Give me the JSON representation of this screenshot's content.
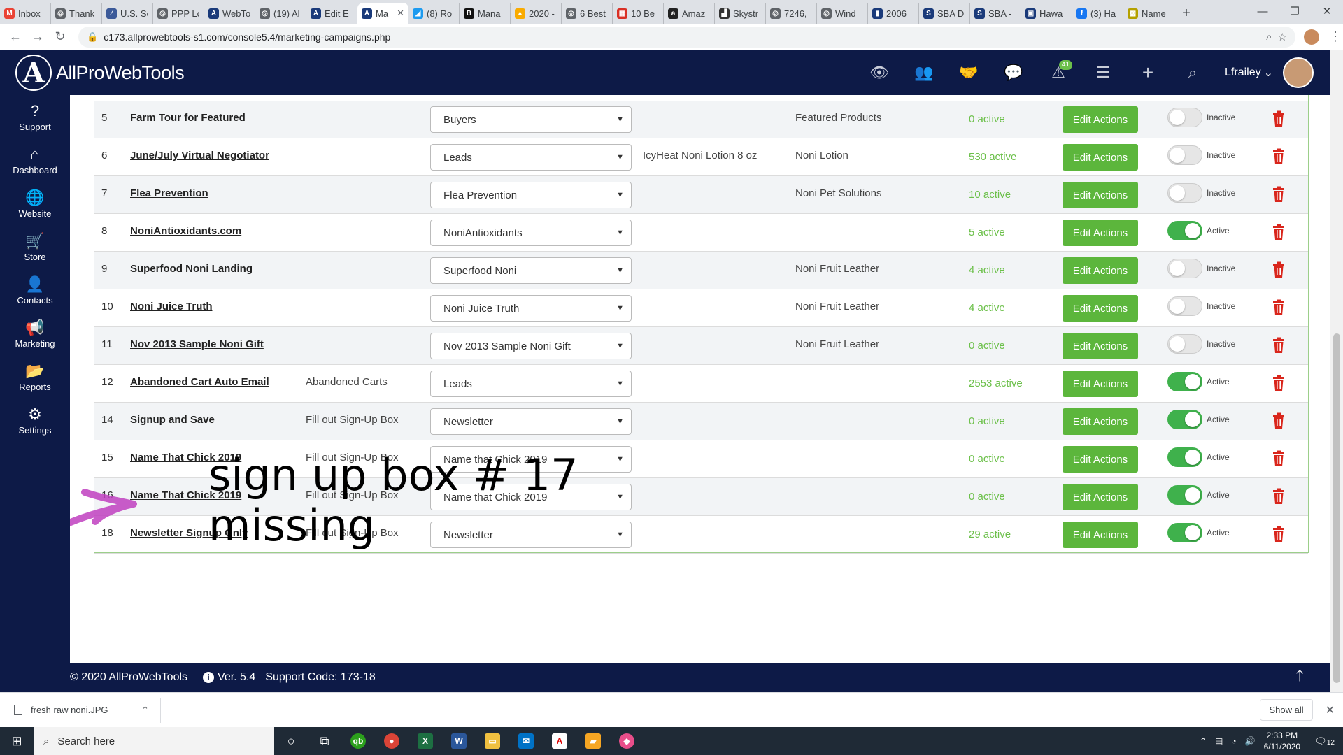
{
  "browser": {
    "tabs": [
      {
        "title": "Inbox",
        "color": "#ea4335",
        "glyph": "M"
      },
      {
        "title": "Thank",
        "color": "#5f6368",
        "glyph": "◎"
      },
      {
        "title": "U.S. Se",
        "color": "#3c5a99",
        "glyph": "⁄"
      },
      {
        "title": "PPP Lo",
        "color": "#5f6368",
        "glyph": "◎"
      },
      {
        "title": "WebTo",
        "color": "#1a3a7a",
        "glyph": "A"
      },
      {
        "title": "(19) Al",
        "color": "#5f6368",
        "glyph": "◎"
      },
      {
        "title": "Edit E",
        "color": "#1a3a7a",
        "glyph": "A"
      },
      {
        "title": "Ma",
        "color": "#1a3a7a",
        "glyph": "A"
      },
      {
        "title": "(8) Ro",
        "color": "#1d9bf0",
        "glyph": "◢"
      },
      {
        "title": "Mana",
        "color": "#111",
        "glyph": "B"
      },
      {
        "title": "2020 -",
        "color": "#f9ab00",
        "glyph": "▲"
      },
      {
        "title": "6 Best",
        "color": "#5f6368",
        "glyph": "◎"
      },
      {
        "title": "10 Be",
        "color": "#d93025",
        "glyph": "▦"
      },
      {
        "title": "Amaz",
        "color": "#222",
        "glyph": "a"
      },
      {
        "title": "Skystr",
        "color": "#333",
        "glyph": "▟"
      },
      {
        "title": "7246,",
        "color": "#5f6368",
        "glyph": "◎"
      },
      {
        "title": "Wind",
        "color": "#5f6368",
        "glyph": "◎"
      },
      {
        "title": "2006",
        "color": "#1a3a7a",
        "glyph": "▮"
      },
      {
        "title": "SBA D",
        "color": "#1a3a7a",
        "glyph": "S"
      },
      {
        "title": "SBA -",
        "color": "#1a3a7a",
        "glyph": "S"
      },
      {
        "title": "Hawa",
        "color": "#1a3a7a",
        "glyph": "▣"
      },
      {
        "title": "(3) Ha",
        "color": "#1877f2",
        "glyph": "f"
      },
      {
        "title": "Name",
        "color": "#b5a100",
        "glyph": "▩"
      }
    ],
    "active_tab_index": 7,
    "url": "c173.allprowebtools-s1.com/console5.4/marketing-campaigns.php"
  },
  "header": {
    "logo_letter": "A",
    "brand": "AllProWebTools",
    "notification_count": "41",
    "username": "Lfrailey"
  },
  "sidebar": {
    "items": [
      {
        "label": "Support",
        "icon": "question-circle-icon",
        "glyph": "?"
      },
      {
        "label": "Dashboard",
        "icon": "home-icon",
        "glyph": "⌂"
      },
      {
        "label": "Website",
        "icon": "globe-icon",
        "glyph": "🌐"
      },
      {
        "label": "Store",
        "icon": "shopping-cart-icon",
        "glyph": "🛒"
      },
      {
        "label": "Contacts",
        "icon": "user-icon",
        "glyph": "👤"
      },
      {
        "label": "Marketing",
        "icon": "megaphone-icon",
        "glyph": "📢"
      },
      {
        "label": "Reports",
        "icon": "folder-icon",
        "glyph": "📂"
      },
      {
        "label": "Settings",
        "icon": "gear-icon",
        "glyph": "⚙"
      }
    ]
  },
  "campaigns": {
    "edit_label": "Edit Actions",
    "rows": [
      {
        "id": "5",
        "name": "Farm Tour for Featured",
        "trigger": "",
        "list": "Buyers",
        "product": "",
        "category": "Featured Products",
        "count": "0 active",
        "active": false,
        "status": "Inactive"
      },
      {
        "id": "6",
        "name": "June/July Virtual Negotiator",
        "trigger": "",
        "list": "Leads",
        "product": "IcyHeat Noni Lotion 8 oz",
        "category": "Noni Lotion",
        "count": "530 active",
        "active": false,
        "status": "Inactive"
      },
      {
        "id": "7",
        "name": "Flea Prevention",
        "trigger": "",
        "list": "Flea Prevention",
        "product": "",
        "category": "Noni Pet Solutions",
        "count": "10 active",
        "active": false,
        "status": "Inactive"
      },
      {
        "id": "8",
        "name": "NoniAntioxidants.com",
        "trigger": "",
        "list": "NoniAntioxidants",
        "product": "",
        "category": "",
        "count": "5 active",
        "active": true,
        "status": "Active"
      },
      {
        "id": "9",
        "name": "Superfood Noni Landing",
        "trigger": "",
        "list": "Superfood Noni",
        "product": "",
        "category": "Noni Fruit Leather",
        "count": "4 active",
        "active": false,
        "status": "Inactive"
      },
      {
        "id": "10",
        "name": "Noni Juice Truth",
        "trigger": "",
        "list": "Noni Juice Truth",
        "product": "",
        "category": "Noni Fruit Leather",
        "count": "4 active",
        "active": false,
        "status": "Inactive"
      },
      {
        "id": "11",
        "name": "Nov 2013 Sample Noni Gift",
        "trigger": "",
        "list": "Nov 2013 Sample Noni Gift",
        "product": "",
        "category": "Noni Fruit Leather",
        "count": "0 active",
        "active": false,
        "status": "Inactive"
      },
      {
        "id": "12",
        "name": "Abandoned Cart Auto Email",
        "trigger": "Abandoned Carts",
        "list": "Leads",
        "product": "",
        "category": "",
        "count": "2553 active",
        "active": true,
        "status": "Active"
      },
      {
        "id": "14",
        "name": "Signup and Save",
        "trigger": "Fill out Sign-Up Box",
        "list": "Newsletter",
        "product": "",
        "category": "",
        "count": "0 active",
        "active": true,
        "status": "Active"
      },
      {
        "id": "15",
        "name": "Name That Chick 2019",
        "trigger": "Fill out Sign-Up Box",
        "list": "Name that Chick 2019",
        "product": "",
        "category": "",
        "count": "0 active",
        "active": true,
        "status": "Active"
      },
      {
        "id": "16",
        "name": "Name That Chick 2019",
        "trigger": "Fill out Sign-Up Box",
        "list": "Name that Chick 2019",
        "product": "",
        "category": "",
        "count": "0 active",
        "active": true,
        "status": "Active"
      },
      {
        "id": "18",
        "name": "Newsletter Signup Only",
        "trigger": "Fill out Sign-Up Box",
        "list": "Newsletter",
        "product": "",
        "category": "",
        "count": "29 active",
        "active": true,
        "status": "Active"
      }
    ]
  },
  "annotation": {
    "line1": "sign up box # 17",
    "line2": "missing",
    "arrow_color": "#c040c0"
  },
  "footer": {
    "copyright": "© 2020 AllProWebTools",
    "version": "Ver. 5.4",
    "support_code": "Support Code: 173-18"
  },
  "downloads": {
    "file": "fresh raw noni.JPG",
    "show_all": "Show all"
  },
  "taskbar": {
    "search_placeholder": "Search here",
    "time": "2:33 PM",
    "date": "6/11/2020",
    "notifications": "12"
  },
  "colors": {
    "navy": "#0d1a47",
    "green_button": "#5cb63c",
    "toggle_on": "#3fb14c",
    "count_green": "#6cc04a",
    "delete_red": "#d9261c"
  }
}
